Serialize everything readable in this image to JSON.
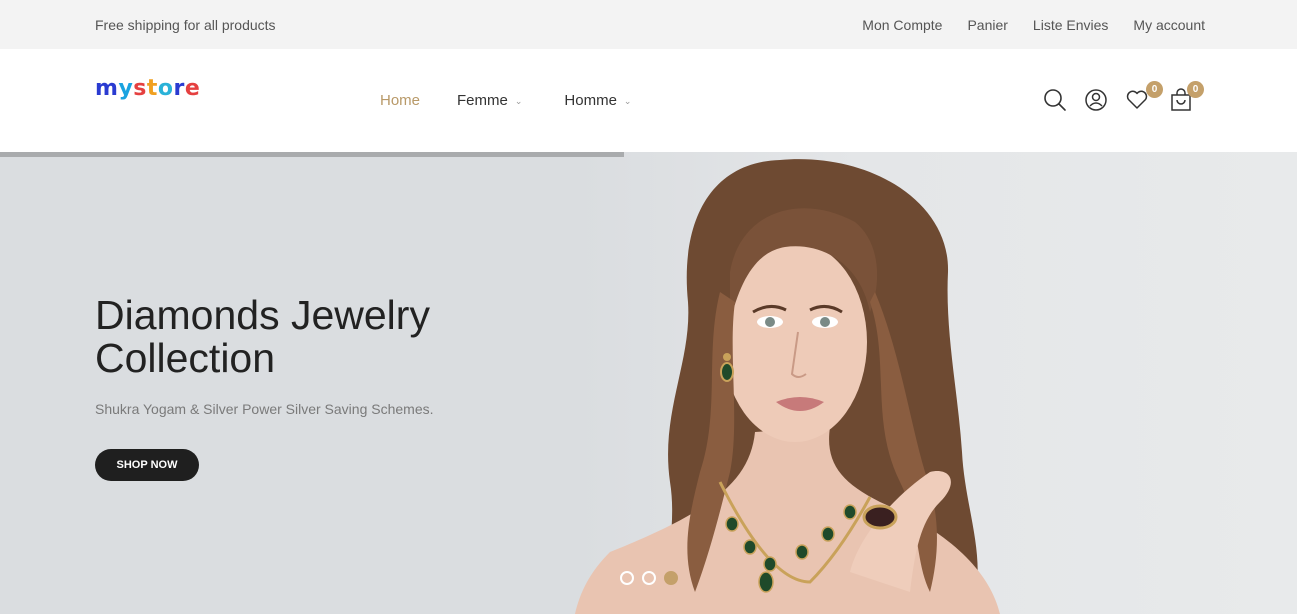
{
  "topbar": {
    "promo": "Free shipping for all products",
    "links": [
      "Mon Compte",
      "Panier",
      "Liste Envies",
      "My account"
    ]
  },
  "header": {
    "logo": {
      "letters": [
        "m",
        "y",
        " ",
        "s",
        "t",
        "o",
        "r",
        "e"
      ]
    },
    "nav": [
      {
        "label": "Home",
        "active": true
      },
      {
        "label": "Femme",
        "dropdown": true
      },
      {
        "label": "Homme",
        "dropdown": true
      }
    ],
    "icons": [
      "search-icon",
      "user-icon",
      "heart-icon",
      "bag-icon"
    ],
    "wishlist_count": "0",
    "cart_count": "0"
  },
  "hero": {
    "title": "Diamonds Jewelry Collection",
    "subtitle": "Shukra Yogam & Silver Power Silver Saving Schemes.",
    "button": "SHOP NOW",
    "slides": 3,
    "active_slide": 3
  },
  "colors": {
    "accent": "#c4a06a",
    "nav_active": "#b89968",
    "hero_bg": "#dadde0",
    "button_bg": "#1f1f1f",
    "topbar_bg": "#f3f3f3"
  }
}
